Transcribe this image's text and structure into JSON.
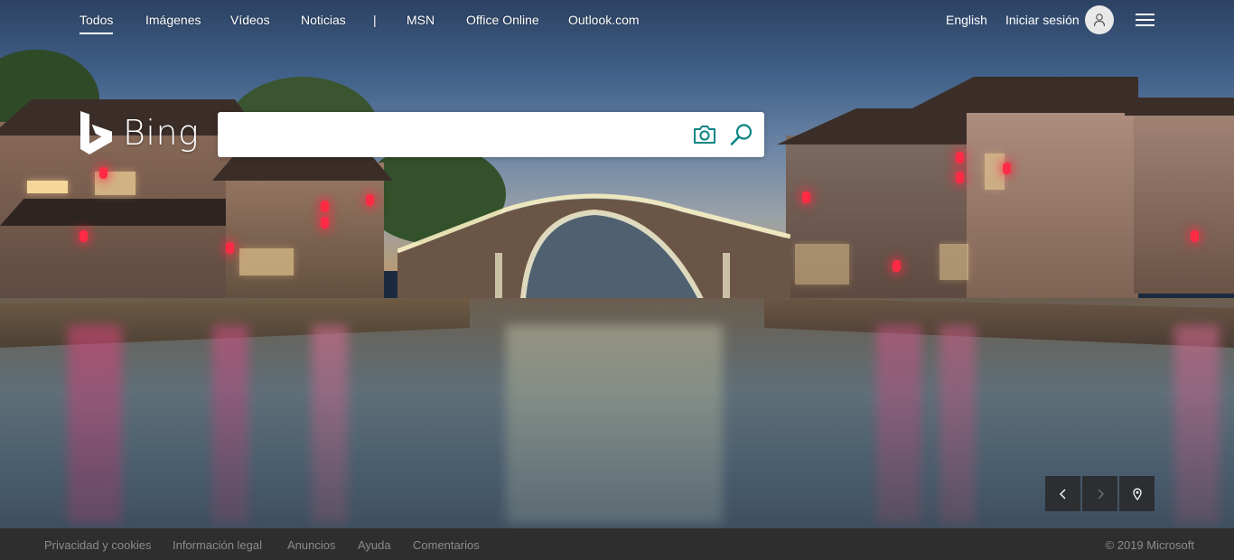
{
  "nav": {
    "items": [
      {
        "label": "Todos",
        "active": true
      },
      {
        "label": "Imágenes"
      },
      {
        "label": "Vídeos"
      },
      {
        "label": "Noticias"
      },
      {
        "label": "|"
      },
      {
        "label": "MSN"
      },
      {
        "label": "Office Online"
      },
      {
        "label": "Outlook.com"
      }
    ],
    "language": "English",
    "sign_in": "Iniciar sesión"
  },
  "logo": {
    "text": "Bing"
  },
  "search": {
    "value": "",
    "placeholder": ""
  },
  "icons": {
    "camera": "camera-icon",
    "search": "search-icon",
    "menu": "hamburger-icon",
    "avatar": "user-icon",
    "prev": "chevron-left-icon",
    "next": "chevron-right-icon",
    "location": "location-pin-icon"
  },
  "footer": {
    "links": [
      "Privacidad y cookies",
      "Información legal",
      "Anuncios",
      "Ayuda",
      "Comentarios"
    ],
    "copyright": "© 2019 Microsoft"
  },
  "colors": {
    "accent": "#0c8484",
    "footer_bg": "#2e2e2e"
  }
}
